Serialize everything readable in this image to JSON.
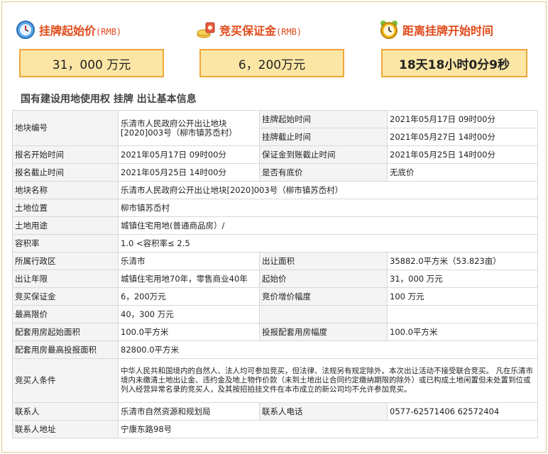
{
  "summary": {
    "start_price": {
      "label": "挂牌起始价",
      "unit": "(RMB)",
      "value": "31，000 万元"
    },
    "deposit": {
      "label": "竞买保证金",
      "unit": "(RMB)",
      "value": "6，200万元"
    },
    "countdown": {
      "label": "距离挂牌开始时间",
      "value": "18天18小时0分9秒"
    }
  },
  "section_title": "国有建设用地使用权 挂牌 出让基本信息",
  "table": {
    "r1": {
      "k1": "地块编号",
      "v1": "乐清市人民政府公开出让地块[2020]003号（柳市镇苏岙村）",
      "k2a": "挂牌起始时间",
      "v2a": "2021年05月17日 09时00分",
      "k2b": "挂牌截止时间",
      "v2b": "2021年05月27日 14时00分"
    },
    "r2": {
      "k1": "报名开始时间",
      "v1": "2021年05月17日 09时00分",
      "k2": "保证金到账截止时间",
      "v2": "2021年05月25日 14时00分"
    },
    "r3": {
      "k1": "报名截止时间",
      "v1": "2021年05月25日 14时00分",
      "k2": "是否有底价",
      "v2": "无底价"
    },
    "r4": {
      "k1": "地块名称",
      "v1": "乐清市人民政府公开出让地块[2020]003号（柳市镇苏岙村）"
    },
    "r5": {
      "k1": "土地位置",
      "v1": "柳市镇苏岙村"
    },
    "r6": {
      "k1": "土地用途",
      "v1": "城镇住宅用地(普通商品房）/"
    },
    "r7": {
      "k1": "容积率",
      "v1": "1.0 <容积率≤ 2.5"
    },
    "r8": {
      "k1": "所属行政区",
      "v1": "乐清市",
      "k2": "出让面积",
      "v2": "35882.0平方米（53.823亩）"
    },
    "r9": {
      "k1": "出让年限",
      "v1": "城镇住宅用地70年，零售商业40年",
      "k2": "起始价",
      "v2": "31，000 万元"
    },
    "r10": {
      "k1": "竞买保证金",
      "v1": "6，200万元",
      "k2": "竞价增价幅度",
      "v2": "100 万元"
    },
    "r11": {
      "k1": "最高限价",
      "v1": "40，300 万元",
      "k2": "",
      "v2": ""
    },
    "r12": {
      "k1": "配套用房起始面积",
      "v1": "100.0平方米",
      "k2": "投报配套用房幅度",
      "v2": "100.0平方米"
    },
    "r13": {
      "k1": "配套用房最高投报面积",
      "v1": "82800.0平方米"
    },
    "r14": {
      "k1": "竞买人条件",
      "v1": "中华人民共和国境内的自然人、法人均可参加竞买，但法律、法规另有规定除外。本次出让活动不接受联合竞买。 凡在乐清市境内未缴清土地出让金、违约金及地上物作价款（未到土地出让合同约定缴纳期限的除外）或已构成土地闲置但未处置到位或列入经营异常名录的竞买人，及其按招拍挂文件在本市成立的新公司均不允许参加竞买。"
    },
    "r15": {
      "k1": "联系人",
      "v1": "乐清市自然资源和规划局",
      "k2": "联系人电话",
      "v2": "0577-62571406 62572404"
    },
    "r16": {
      "k1": "联系人地址",
      "v1": "宁康东路98号"
    }
  },
  "colors": {
    "accent": "#e04a1a",
    "box_bg": "#fbe6a5",
    "box_border": "#f0a63a"
  },
  "icons": {
    "start_price": "clock-icon",
    "deposit": "money-icon",
    "countdown": "alarm-clock-icon"
  }
}
